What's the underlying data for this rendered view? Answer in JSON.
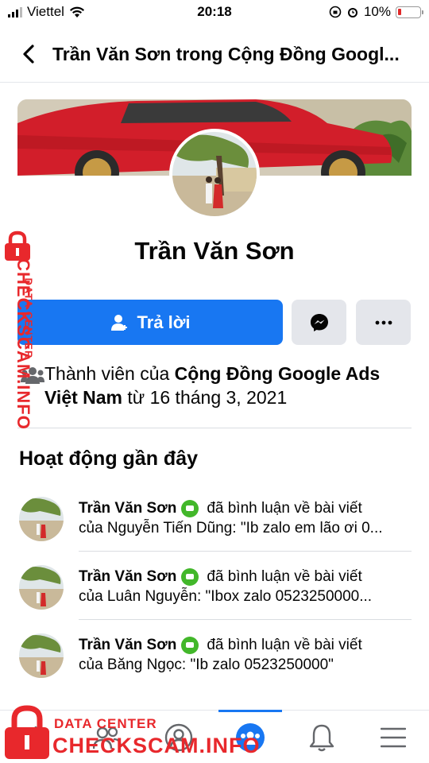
{
  "status_bar": {
    "carrier": "Viettel",
    "time": "20:18",
    "battery": "10%"
  },
  "header": {
    "title": "Trần Văn Sơn trong Cộng Đồng Googl..."
  },
  "profile": {
    "name": "Trần Văn Sơn",
    "reply_label": "Trả lời"
  },
  "membership": {
    "prefix": "Thành viên của ",
    "group": "Cộng Đồng Google Ads Việt Nam",
    "suffix": " từ 16 tháng 3, 2021"
  },
  "recent": {
    "title": "Hoạt động gần đây",
    "items": [
      {
        "user": "Trần Văn Sơn",
        "action": "đã bình luận về bài viết",
        "detail": "của Nguyễn Tiến Dũng: \"Ib zalo em lão ơi 0..."
      },
      {
        "user": "Trần Văn Sơn",
        "action": "đã bình luận về bài viết",
        "detail": "của Luân Nguyễn: \"Ibox zalo 0523250000..."
      },
      {
        "user": "Trần Văn Sơn",
        "action": "đã bình luận về bài viết",
        "detail": "của Băng Ngọc: \"Ib zalo 0523250000\""
      }
    ]
  },
  "watermark": {
    "side_main": "CHECKSCAM.INFO",
    "side_sub": "DATA CENTER",
    "bottom_sub": "DATA CENTER",
    "bottom_main": "CHECKSCAM.INFO"
  },
  "colors": {
    "accent": "#1877f2",
    "watermark": "#e8282c",
    "online": "#42b72a"
  }
}
